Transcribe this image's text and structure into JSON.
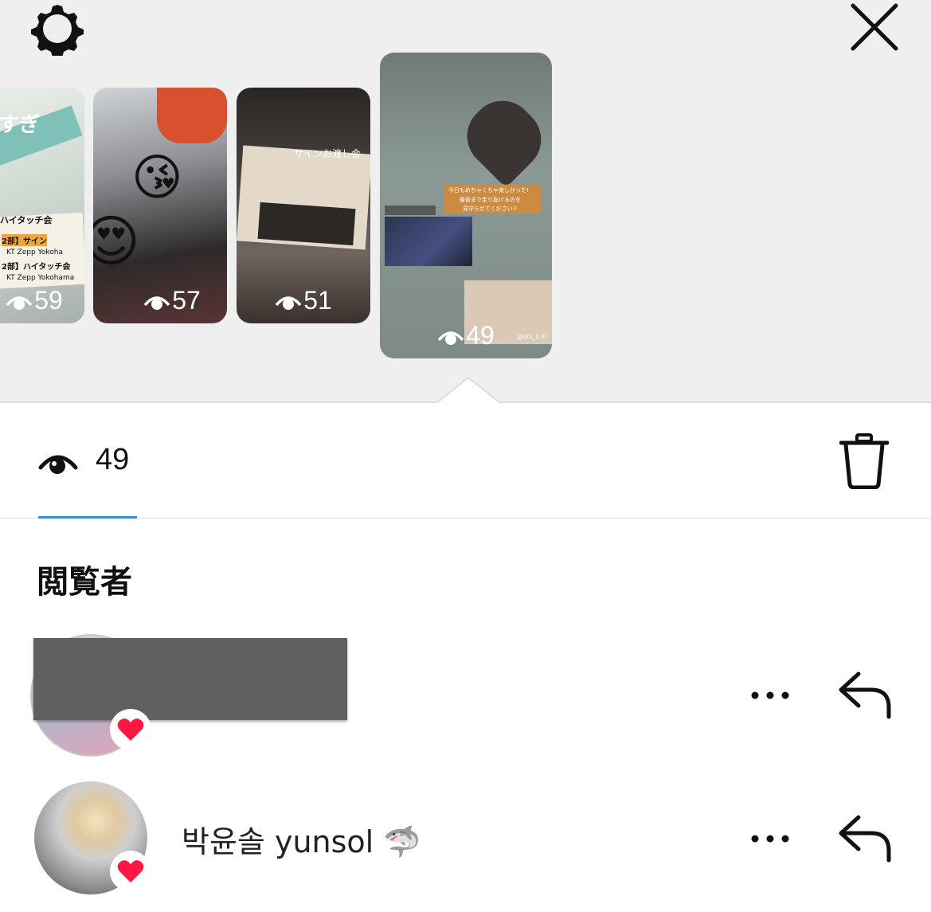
{
  "header": {
    "settings_icon": "gear-icon",
    "close_icon": "close-icon"
  },
  "stories": [
    {
      "views": "59",
      "selected": false,
      "overlay_texts": [
        "すぎ",
        "ハイタッチ会",
        "2部】サイン",
        "KT Zepp Yokoha",
        "2部】ハイタッチ会",
        "KT Zepp Yokohama"
      ]
    },
    {
      "views": "57",
      "selected": false,
      "overlay_texts": []
    },
    {
      "views": "51",
      "selected": false,
      "overlay_texts": [
        "サインお渡し会"
      ]
    },
    {
      "views": "49",
      "selected": true,
      "overlay_texts": [
        "今日もめちゃくちゃ楽しかった!",
        "最後まで走り抜けるのを",
        "見守らせてください!!",
        "@sol_s.lll"
      ]
    }
  ],
  "stats": {
    "views": "49",
    "eye_icon": "eye-icon",
    "delete_icon": "trash-icon"
  },
  "viewers": {
    "heading": "閲覧者",
    "items": [
      {
        "name": "",
        "liked": true
      },
      {
        "name": "박윤솔 yunsol 🦈",
        "liked": true
      }
    ]
  },
  "colors": {
    "top_background": "#efefef",
    "tab_underline": "#3b8fd8",
    "heart": "#ff1744"
  }
}
